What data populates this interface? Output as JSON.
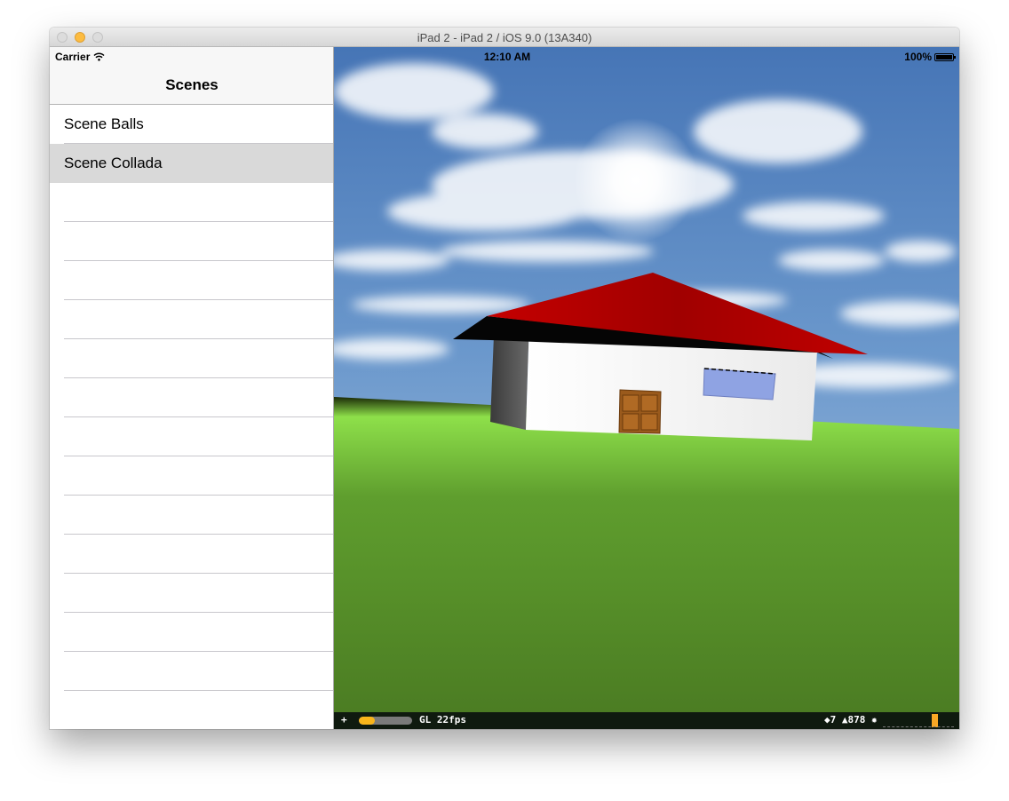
{
  "window": {
    "title": "iPad 2 - iPad 2 / iOS 9.0 (13A340)"
  },
  "status": {
    "carrier": "Carrier",
    "time": "12:10 AM",
    "battery": "100%"
  },
  "master": {
    "title": "Scenes",
    "rows": [
      {
        "label": "Scene Balls",
        "selected": false
      },
      {
        "label": "Scene Collada",
        "selected": true
      }
    ]
  },
  "stats": {
    "plus": "+",
    "fps": "GL 22fps",
    "counts": "◆7 ▲878 ✹",
    "perf_fraction": 0.3
  },
  "colors": {
    "sky_top": "#4a7ab8",
    "grass": "#5c9a2c",
    "roof": "#b00000",
    "selection": "#d9d9d9",
    "accent": "#f9b51b"
  },
  "icons": {
    "wifi": "wifi-icon",
    "battery": "battery-icon"
  }
}
